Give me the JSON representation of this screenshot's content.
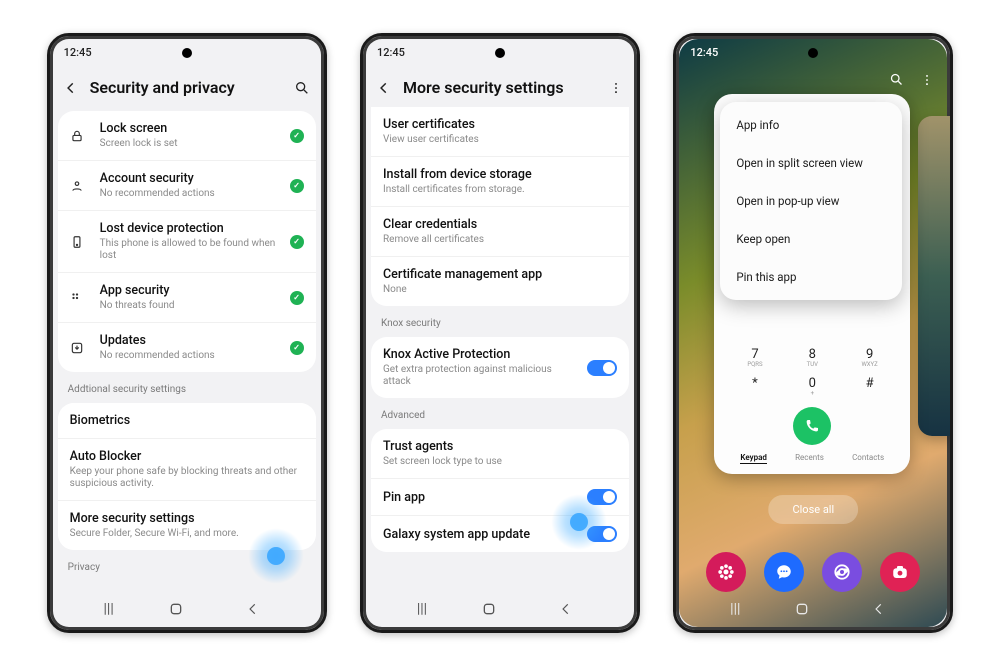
{
  "time": "12:45",
  "phone1": {
    "title": "Security and privacy",
    "rows": [
      {
        "icon": "lock",
        "label": "Lock screen",
        "sub": "Screen lock is set"
      },
      {
        "icon": "account",
        "label": "Account security",
        "sub": "No recommended actions"
      },
      {
        "icon": "device",
        "label": "Lost device protection",
        "sub": "This phone is allowed to be found when lost"
      },
      {
        "icon": "apps",
        "label": "App security",
        "sub": "No threats found"
      },
      {
        "icon": "update",
        "label": "Updates",
        "sub": "No recommended actions"
      }
    ],
    "additional_header": "Addtional security settings",
    "additional": [
      {
        "label": "Biometrics",
        "sub": ""
      },
      {
        "label": "Auto Blocker",
        "sub": "Keep your phone safe by blocking threats and other suspicious activity."
      },
      {
        "label": "More security settings",
        "sub": "Secure Folder, Secure Wi-Fi, and more."
      }
    ],
    "privacy_header": "Privacy"
  },
  "phone2": {
    "title": "More security settings",
    "group1": [
      {
        "label": "User certificates",
        "sub": "View user certificates"
      },
      {
        "label": "Install from device storage",
        "sub": "Install certificates from storage."
      },
      {
        "label": "Clear credentials",
        "sub": "Remove all certificates"
      },
      {
        "label": "Certificate management app",
        "sub": "None"
      }
    ],
    "knox_header": "Knox security",
    "knox_row": {
      "label": "Knox Active Protection",
      "sub": "Get extra protection against malicious attack"
    },
    "advanced_header": "Advanced",
    "advanced": [
      {
        "label": "Trust agents",
        "sub": "Set screen lock type to use",
        "toggle": false
      },
      {
        "label": "Pin app",
        "sub": "",
        "toggle": true
      },
      {
        "label": "Galaxy system app update",
        "sub": "",
        "toggle": true
      }
    ]
  },
  "phone3": {
    "menu": [
      "App info",
      "Open in split screen view",
      "Open in pop-up view",
      "Keep open",
      "Pin this app"
    ],
    "dial_row1": [
      {
        "k": "7",
        "s": "PQRS"
      },
      {
        "k": "8",
        "s": "TUV"
      },
      {
        "k": "9",
        "s": "WXYZ"
      }
    ],
    "dial_row2": [
      {
        "k": "*",
        "s": ""
      },
      {
        "k": "0",
        "s": "+"
      },
      {
        "k": "#",
        "s": ""
      }
    ],
    "tabs": {
      "keypad": "Keypad",
      "recents": "Recents",
      "contacts": "Contacts"
    },
    "close_all": "Close all"
  }
}
